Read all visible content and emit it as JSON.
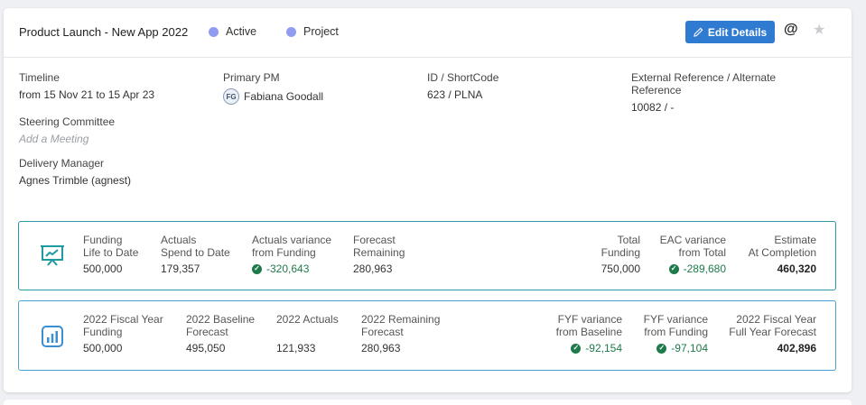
{
  "header": {
    "title": "Product Launch - New App 2022",
    "status_1": "Active",
    "status_2": "Project",
    "edit_label": "Edit Details",
    "at_symbol": "@",
    "star_symbol": "★",
    "status_color": "#8f9cf0"
  },
  "details": {
    "timeline_label": "Timeline",
    "timeline_value": "from 15 Nov 21 to 15 Apr 23",
    "steering_label": "Steering Committee",
    "steering_value": "Add a Meeting",
    "delivery_label": "Delivery Manager",
    "delivery_value": "Agnes Trimble (agnest)",
    "pm_label": "Primary PM",
    "pm_initials": "FG",
    "pm_value": "Fabiana Goodall",
    "id_label": "ID / ShortCode",
    "id_value": "623 / PLNA",
    "extref_label_1": "External Reference / Alternate",
    "extref_label_2": "Reference",
    "extref_value": "10082 / -"
  },
  "life_to_date": {
    "icon": "presentation-chart-icon",
    "funding": {
      "l1": "Funding",
      "l2": "Life to Date",
      "v": "500,000"
    },
    "actuals": {
      "l1": "Actuals",
      "l2": "Spend to Date",
      "v": "179,357"
    },
    "actuals_var": {
      "l1": "Actuals variance",
      "l2": "from Funding",
      "v": "-320,643"
    },
    "forecast": {
      "l1": "Forecast",
      "l2": "Remaining",
      "v": "280,963"
    },
    "total": {
      "l1": "Total",
      "l2": "Funding",
      "v": "750,000"
    },
    "eac_var": {
      "l1": "EAC variance",
      "l2": "from Total",
      "v": "-289,680"
    },
    "estimate": {
      "l1": "Estimate",
      "l2": "At Completion",
      "v": "460,320"
    }
  },
  "fiscal_year": {
    "icon": "bar-chart-icon",
    "fy_funding": {
      "l1": "2022 Fiscal Year",
      "l2": "Funding",
      "v": "500,000"
    },
    "baseline": {
      "l1": "2022 Baseline",
      "l2": "Forecast",
      "v": "495,050"
    },
    "actuals": {
      "l1": "2022 Actuals",
      "v": "121,933"
    },
    "remaining": {
      "l1": "2022 Remaining",
      "l2": "Forecast",
      "v": "280,963"
    },
    "fyf_base": {
      "l1": "FYF variance",
      "l2": "from Baseline",
      "v": "-92,154"
    },
    "fyf_fund": {
      "l1": "FYF variance",
      "l2": "from Funding",
      "v": "-97,104"
    },
    "full_year": {
      "l1": "2022 Fiscal Year",
      "l2": "Full Year Forecast",
      "v": "402,896"
    }
  }
}
